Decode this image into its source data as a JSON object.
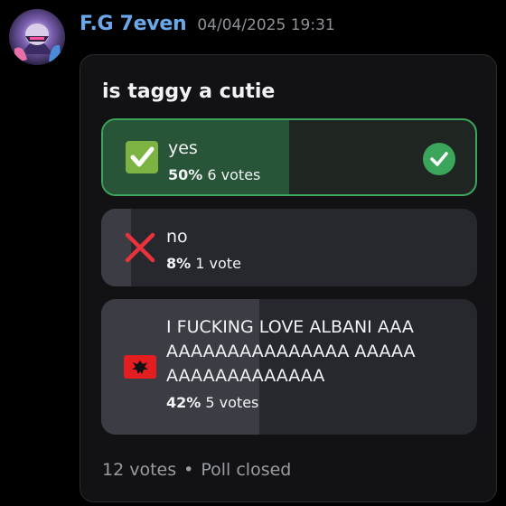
{
  "message": {
    "username": "F.G 7even",
    "timestamp": "04/04/2025 19:31"
  },
  "poll": {
    "question": "is taggy a cutie",
    "answers": [
      {
        "emoji": "white-check-mark-emoji",
        "label": "yes",
        "percent": "50%",
        "votes": "6 votes",
        "fraction": 0.5,
        "winner": true
      },
      {
        "emoji": "cross-mark-emoji",
        "label": "no",
        "percent": "8%",
        "votes": "1 vote",
        "fraction": 0.08,
        "winner": false
      },
      {
        "emoji": "albania-flag-emoji",
        "label": "I FUCKING LOVE ALBANI AAAAAAAAAAAAAAAAAA AAAAAAAAAAAAAAAAAA",
        "percent": "42%",
        "votes": "5 votes",
        "fraction": 0.42,
        "winner": false
      }
    ],
    "total_votes": "12 votes",
    "status": "Poll closed"
  },
  "colors": {
    "username": "#6aa8ea",
    "winner_border": "#3ba55c",
    "winner_fill": "#285437",
    "answer_bg": "#27282e",
    "answer_fill": "#3c3d44"
  }
}
